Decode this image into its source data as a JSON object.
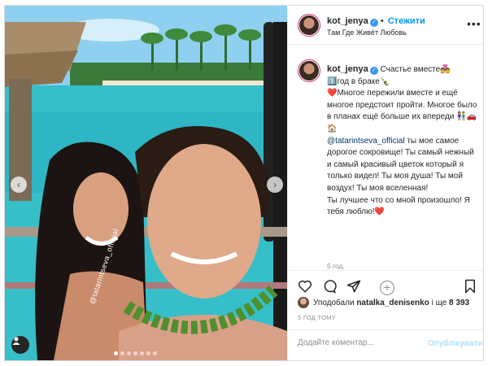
{
  "post": {
    "username": "kot_jenya",
    "follow_label": "Стежити",
    "location": "Там Где Живёт Любовь",
    "photo_tag_text": "@tatarintseva_official",
    "carousel_total": 7,
    "carousel_active_index": 0
  },
  "caption": {
    "line1_after_name": " Счастье вместе💑",
    "line2": "1️⃣год в браке🍾",
    "line3": "❤️Многое пережили вместе и ещё многое предстоит пройти. Многое было в планах ещё больше их впереди 👫🚗🏠",
    "mention": "@tatarintseva_official",
    "line4": " ты мое самое дорогое сокровище! Ты самый нежный и самый красивый цветок который я только видел! Ты моя душа! Ты мой воздух! Ты моя вселенная!",
    "line5": "Ты лучшее что со мной произошло! Я тебя люблю!❤️",
    "time": "5 год."
  },
  "likes": {
    "prefix": "Уподобали ",
    "user": "natalka_denisenko",
    "middle": " і ще ",
    "count": "8 393"
  },
  "timestamp": "5 ГОД ТОМУ",
  "comment": {
    "placeholder": "Додайте коментар...",
    "publish_label": "Опублікувати"
  },
  "colors": {
    "link": "#0095f6",
    "mention": "#00376b",
    "secondary_text": "#8e8e8e",
    "heart": "#ed4956"
  }
}
